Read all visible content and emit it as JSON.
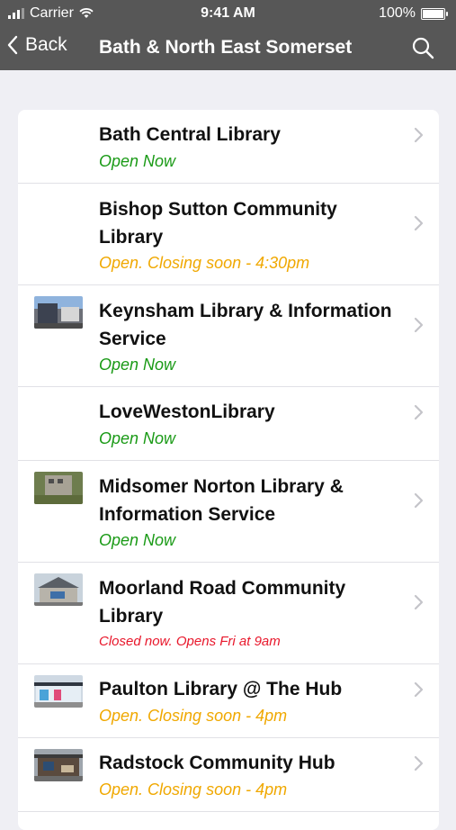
{
  "status_bar": {
    "carrier": "Carrier",
    "time": "9:41 AM",
    "battery": "100%"
  },
  "nav": {
    "back_label": "Back",
    "title": "Bath & North East Somerset"
  },
  "libraries": [
    {
      "name": "Bath Central Library",
      "status": "Open Now",
      "status_type": "open",
      "has_photo": false
    },
    {
      "name": "Bishop Sutton Community Library",
      "status": "Open. Closing soon - 4:30pm",
      "status_type": "closing",
      "has_photo": false
    },
    {
      "name": "Keynsham Library & Information Service",
      "status": "Open Now",
      "status_type": "open",
      "has_photo": true
    },
    {
      "name": "LoveWestonLibrary",
      "status": "Open Now",
      "status_type": "open",
      "has_photo": false
    },
    {
      "name": "Midsomer Norton Library & Information Service",
      "status": "Open Now",
      "status_type": "open",
      "has_photo": true
    },
    {
      "name": "Moorland Road Community Library",
      "status": "Closed now. Opens Fri at 9am",
      "status_type": "closed",
      "has_photo": true
    },
    {
      "name": "Paulton Library @ The Hub",
      "status": "Open. Closing soon - 4pm",
      "status_type": "closing",
      "has_photo": true
    },
    {
      "name": "Radstock Community Hub",
      "status": "Open. Closing soon - 4pm",
      "status_type": "closing",
      "has_photo": true
    }
  ],
  "colors": {
    "bar": "#575757",
    "open": "#1a9a16",
    "closing": "#f0a800",
    "closed": "#e8172b"
  }
}
